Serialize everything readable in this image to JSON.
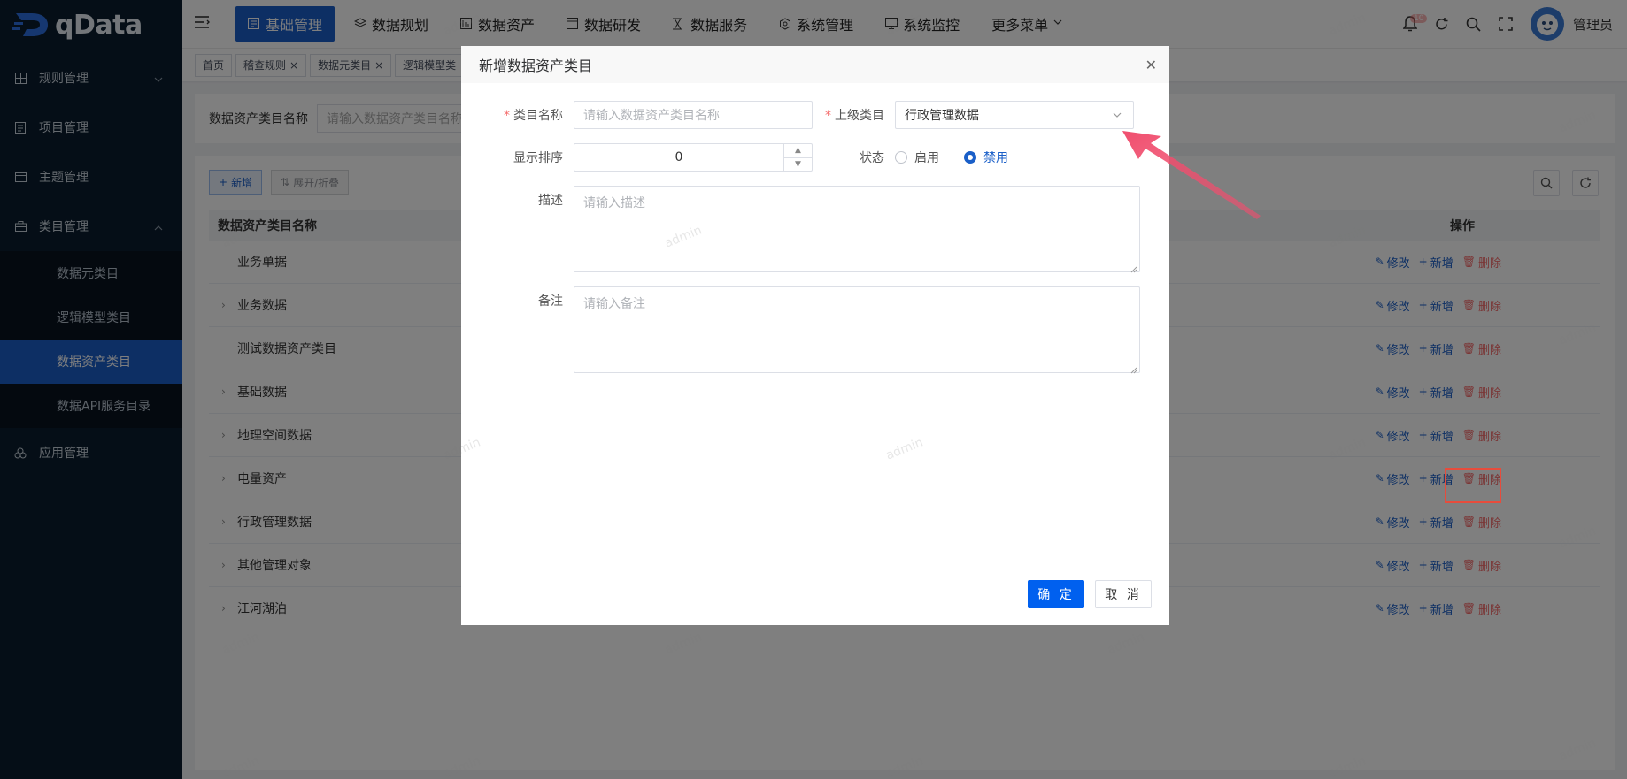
{
  "logo": {
    "text": "qData"
  },
  "sidebar": {
    "items": [
      {
        "label": "规则管理",
        "icon": "grid-icon",
        "expanded": false
      },
      {
        "label": "项目管理",
        "icon": "document-icon"
      },
      {
        "label": "主题管理",
        "icon": "calendar-icon"
      },
      {
        "label": "类目管理",
        "icon": "briefcase-icon",
        "expanded": true
      },
      {
        "label": "应用管理",
        "icon": "cluster-icon"
      }
    ],
    "sub_items": [
      {
        "label": "数据元类目"
      },
      {
        "label": "逻辑模型类目"
      },
      {
        "label": "数据资产类目",
        "active": true
      },
      {
        "label": "数据API服务目录"
      }
    ]
  },
  "header": {
    "nav": [
      {
        "label": "基础管理",
        "icon": "dashboard-icon",
        "active": true
      },
      {
        "label": "数据规划",
        "icon": "layers-icon"
      },
      {
        "label": "数据资产",
        "icon": "database-icon"
      },
      {
        "label": "数据研发",
        "icon": "code-window-icon"
      },
      {
        "label": "数据服务",
        "icon": "hourglass-icon"
      },
      {
        "label": "系统管理",
        "icon": "settings-hex-icon"
      },
      {
        "label": "系统监控",
        "icon": "monitor-icon"
      },
      {
        "label": "更多菜单",
        "icon": "chevron-down-icon"
      }
    ],
    "notification_count": "10",
    "username": "管理员"
  },
  "tags": [
    {
      "label": "首页",
      "closable": false
    },
    {
      "label": "稽查规则",
      "closable": true
    },
    {
      "label": "数据元类目",
      "closable": true
    },
    {
      "label": "逻辑模型类",
      "closable": false
    }
  ],
  "search": {
    "label": "数据资产类目名称",
    "placeholder": "请输入数据资产类目名称"
  },
  "toolbar": {
    "add_label": "新增",
    "expand_label": "展开/折叠"
  },
  "table": {
    "col_name": "数据资产类目名称",
    "col_ops": "操作",
    "rows": [
      {
        "name": "业务单据",
        "has_children": false
      },
      {
        "name": "业务数据",
        "has_children": true
      },
      {
        "name": "测试数据资产类目",
        "has_children": false
      },
      {
        "name": "基础数据",
        "has_children": true
      },
      {
        "name": "地理空间数据",
        "has_children": true
      },
      {
        "name": "电量资产",
        "has_children": true
      },
      {
        "name": "行政管理数据",
        "has_children": true
      },
      {
        "name": "其他管理对象",
        "has_children": true
      },
      {
        "name": "江河湖泊",
        "has_children": true
      }
    ],
    "action_labels": {
      "edit": "修改",
      "add": "新增",
      "delete": "删除"
    }
  },
  "modal": {
    "title": "新增数据资产类目",
    "fields": {
      "name_label": "类目名称",
      "name_placeholder": "请输入数据资产类目名称",
      "parent_label": "上级类目",
      "parent_value": "行政管理数据",
      "order_label": "显示排序",
      "order_value": "0",
      "status_label": "状态",
      "status_options": [
        "启用",
        "禁用"
      ],
      "status_selected": "禁用",
      "desc_label": "描述",
      "desc_placeholder": "请输入描述",
      "remark_label": "备注",
      "remark_placeholder": "请输入备注"
    },
    "ok_label": "确 定",
    "cancel_label": "取 消"
  },
  "watermark_text": "admin",
  "colors": {
    "primary": "#1a5fc8",
    "danger": "#f56c6c",
    "sidebar_bg": "#0b1c2e",
    "annotation": "#f04e6e"
  }
}
